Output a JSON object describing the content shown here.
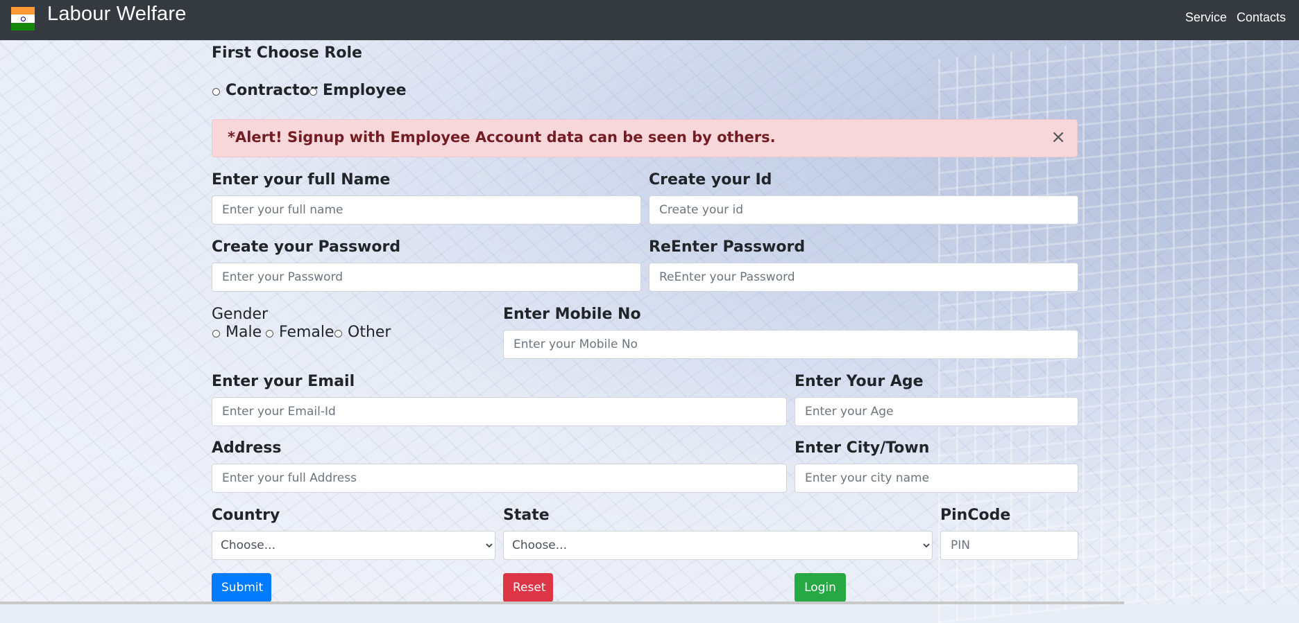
{
  "navbar": {
    "brand": "Labour Welfare",
    "links": [
      "Service",
      "Contacts"
    ],
    "flag_colors": [
      "#ff9933",
      "#ffffff",
      "#138808"
    ]
  },
  "role": {
    "title": "First Choose Role",
    "options": [
      "Contractor",
      "Employee"
    ]
  },
  "alert": {
    "strong": "*Alert!",
    "message": " Signup with Employee Account data can be seen by others.",
    "close": "×"
  },
  "form": {
    "full_name": {
      "label": "Enter your full Name",
      "placeholder": "Enter your full name"
    },
    "user_id": {
      "label": "Create your Id",
      "placeholder": "Create your id"
    },
    "password": {
      "label": "Create your Password",
      "placeholder": "Enter your Password"
    },
    "reenter": {
      "label": "ReEnter Password",
      "placeholder": "ReEnter your Password"
    },
    "gender": {
      "label": "Gender",
      "options": [
        "Male",
        "Female",
        "Other"
      ]
    },
    "mobile": {
      "label": "Enter Mobile No",
      "placeholder": "Enter your Mobile No"
    },
    "email": {
      "label": "Enter your Email",
      "placeholder": "Enter your Email-Id"
    },
    "age": {
      "label": "Enter Your Age",
      "placeholder": "Enter your Age"
    },
    "address": {
      "label": "Address",
      "placeholder": "Enter your full Address"
    },
    "city": {
      "label": "Enter City/Town",
      "placeholder": "Enter your city name"
    },
    "country": {
      "label": "Country",
      "selected": "Choose..."
    },
    "state": {
      "label": "State",
      "selected": "Choose..."
    },
    "pincode": {
      "label": "PinCode",
      "placeholder": "PIN"
    }
  },
  "buttons": {
    "submit": "Submit",
    "reset": "Reset",
    "login": "Login"
  }
}
